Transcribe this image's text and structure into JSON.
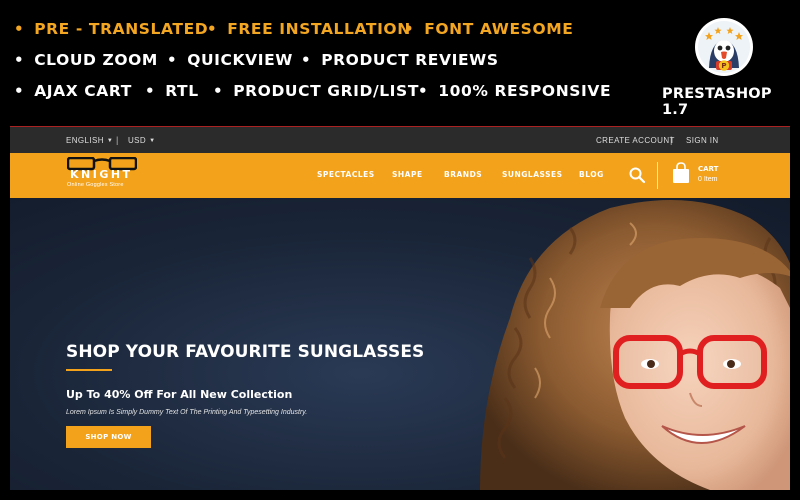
{
  "promo": {
    "rows": [
      [
        "PRE - TRANSLATED",
        "FREE INSTALLATION",
        "FONT AWESOME"
      ],
      [
        "CLOUD ZOOM",
        "QUICKVIEW",
        "PRODUCT REVIEWS"
      ],
      [
        "AJAX CART",
        "RTL",
        "PRODUCT GRID/LIST",
        "100% RESPONSIVE"
      ]
    ],
    "bullet": "•",
    "platform_label": "PRESTASHOP 1.7",
    "badge_icon": "prestashop-puffin-logo",
    "badge_letter": "P"
  },
  "store": {
    "topbar": {
      "language": "ENGLISH",
      "currency": "USD",
      "separator": "|",
      "create_account": "CREATE ACCOUNT",
      "sign_in": "SIGN IN"
    },
    "logo": {
      "name": "KNIGHT",
      "tagline": "Online Goggles Store",
      "icon": "eyeglasses-icon"
    },
    "menu": [
      "SPECTACLES",
      "SHAPE",
      "BRANDS",
      "SUNGLASSES",
      "BLOG"
    ],
    "search_icon": "search-icon",
    "cart": {
      "label": "CART",
      "count": "0 Item",
      "icon": "shopping-bag-icon"
    },
    "hero": {
      "title": "SHOP YOUR FAVOURITE SUNGLASSES",
      "subtitle": "Up To 40% Off For All New Collection",
      "description": "Lorem Ipsum Is Simply Dummy Text Of The Printing And Typesetting Industry.",
      "button": "SHOP NOW"
    }
  },
  "colors": {
    "accent": "#f3a21c",
    "feature_highlight": "#f3a622",
    "topbar_bg": "#2b2b2b",
    "hero_bg": "#1b2638",
    "glasses_frame": "#e02020"
  }
}
